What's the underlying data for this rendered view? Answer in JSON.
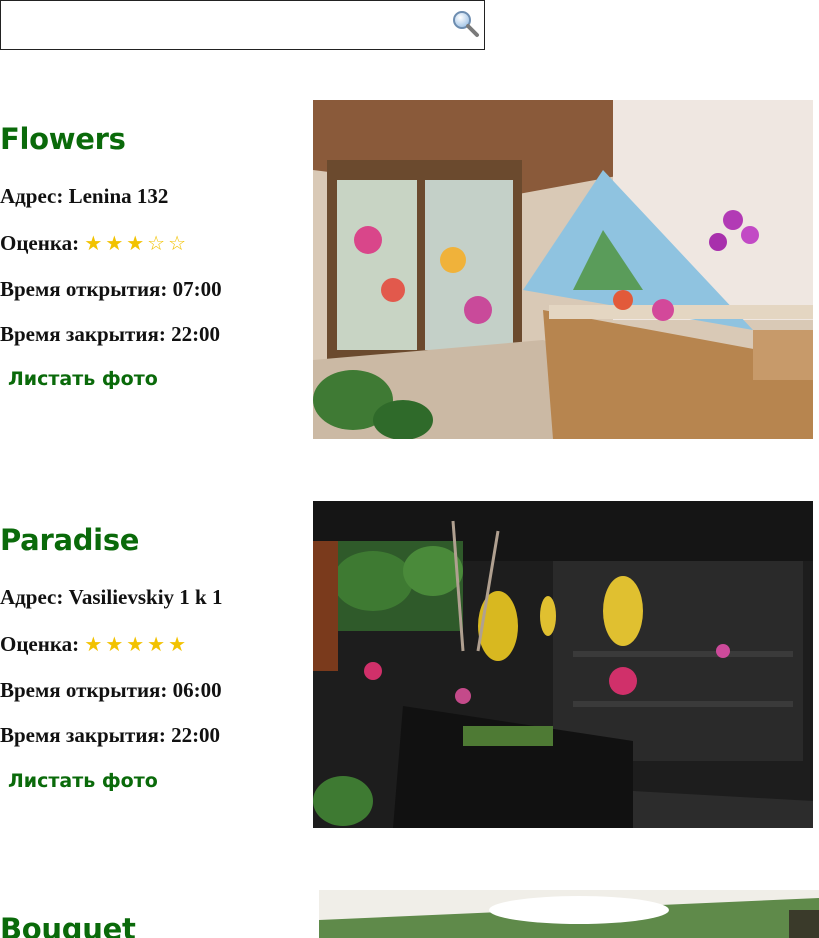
{
  "search": {
    "placeholder": "",
    "value": ""
  },
  "shops": [
    {
      "name": "Flowers",
      "address_label": "Адрес:",
      "address": "Lenina 132",
      "rating_label": "Оценка:",
      "rating": 3,
      "rating_max": 5,
      "stars": "★★★☆☆",
      "open_label": "Время открытия:",
      "open_time": "07:00",
      "close_label": "Время закрытия:",
      "close_time": "22:00",
      "photo_link": "Листать фото"
    },
    {
      "name": "Paradise",
      "address_label": "Адрес:",
      "address": "Vasilievskiy 1 k 1",
      "rating_label": "Оценка:",
      "rating": 5,
      "rating_max": 5,
      "stars": "★★★★★",
      "open_label": "Время открытия:",
      "open_time": "06:00",
      "close_label": "Время закрытия:",
      "close_time": "22:00",
      "photo_link": "Листать фото"
    },
    {
      "name": "Bouquet"
    }
  ],
  "colors": {
    "heading": "#0a6a0a",
    "star": "#f2c200",
    "text": "#111111"
  },
  "icons": {
    "search": "magnifier-icon"
  }
}
